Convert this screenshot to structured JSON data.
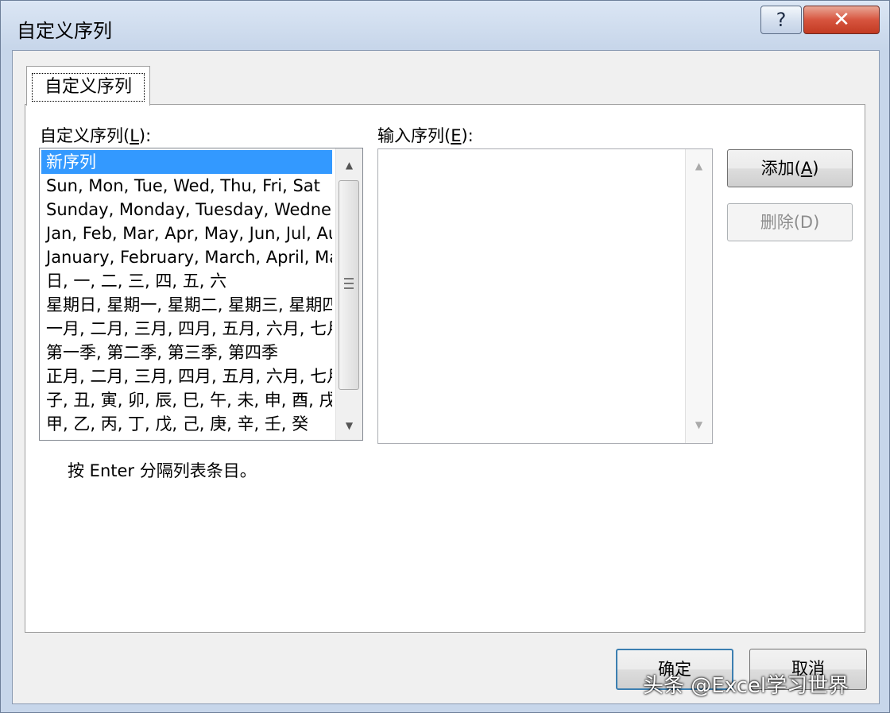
{
  "window": {
    "title": "自定义序列"
  },
  "tab": {
    "label": "自定义序列"
  },
  "list_section": {
    "label_prefix": "自定义序列(",
    "label_key": "L",
    "label_suffix": "):",
    "items": [
      "新序列",
      "Sun, Mon, Tue, Wed, Thu, Fri, Sat",
      "Sunday, Monday, Tuesday, Wednesday, Thursday, Friday, Saturday",
      "Jan, Feb, Mar, Apr, May, Jun, Jul, Aug, Sep, Oct, Nov, Dec",
      "January, February, March, April, May, June, July, August, September, October, November, December",
      "日, 一, 二, 三, 四, 五, 六",
      "星期日, 星期一, 星期二, 星期三, 星期四, 星期五, 星期六",
      "一月, 二月, 三月, 四月, 五月, 六月, 七月, 八月, 九月, 十月, 十一月, 十二月",
      "第一季, 第二季, 第三季, 第四季",
      "正月, 二月, 三月, 四月, 五月, 六月, 七月, 八月, 九月, 十月, 冬月, 腊月",
      "子, 丑, 寅, 卯, 辰, 巳, 午, 未, 申, 酉, 戌, 亥",
      "甲, 乙, 丙, 丁, 戊, 己, 庚, 辛, 壬, 癸"
    ],
    "selected_index": 0
  },
  "entry_section": {
    "label_prefix": "输入序列(",
    "label_key": "E",
    "label_suffix": "):",
    "value": ""
  },
  "buttons": {
    "add": {
      "prefix": "添加(",
      "key": "A",
      "suffix": ")"
    },
    "delete": "删除(D)",
    "ok": "确定",
    "cancel": "取消"
  },
  "hint": "按 Enter 分隔列表条目。",
  "watermark": "头条 @Excel学习世界",
  "icons": {
    "help": "?",
    "close": "✕",
    "scroll_up": "▲",
    "scroll_down": "▼"
  }
}
